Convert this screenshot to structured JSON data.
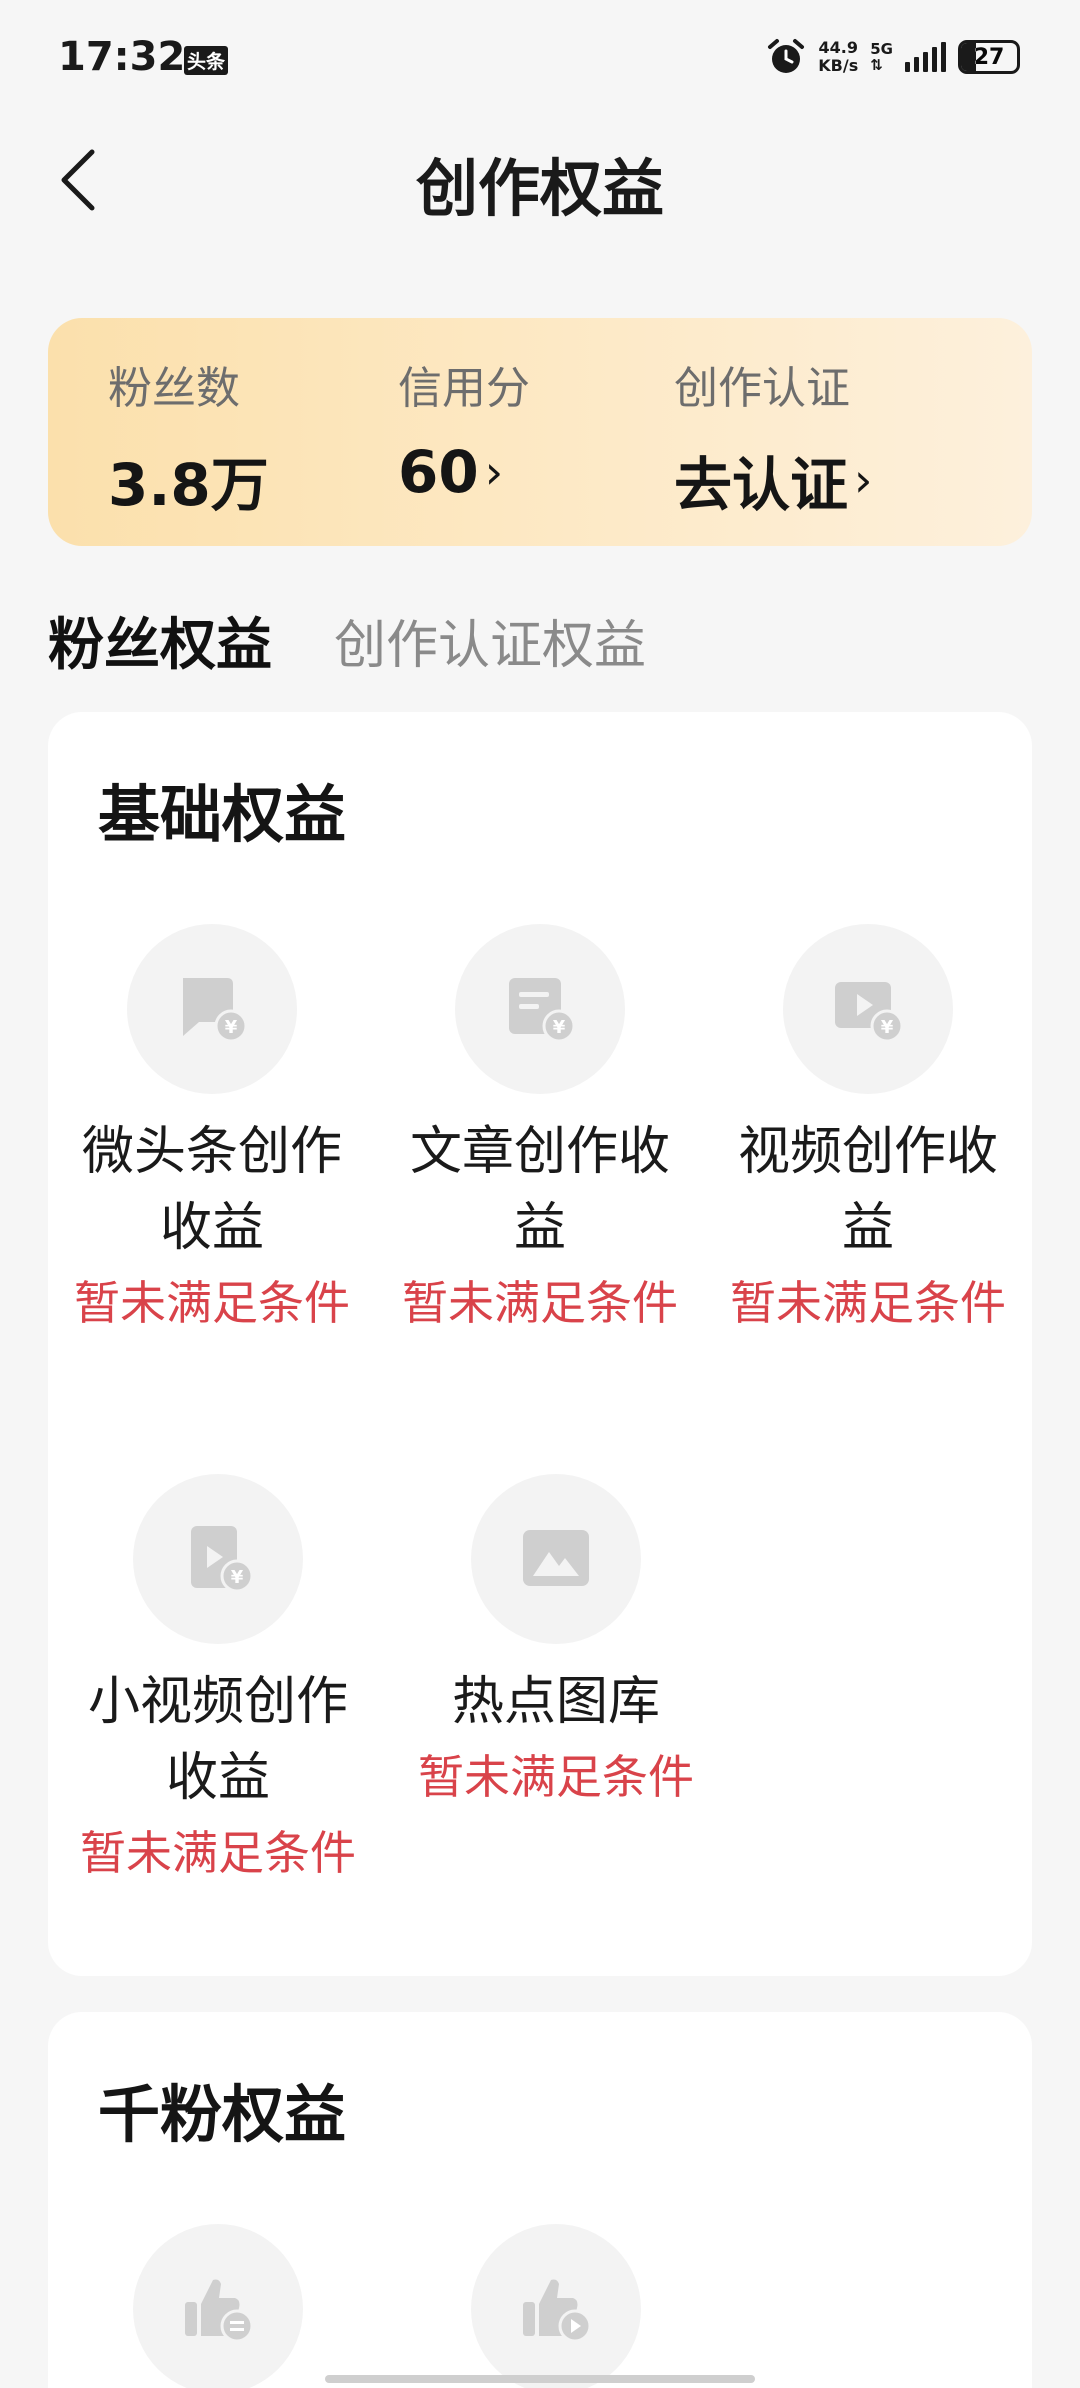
{
  "status_bar": {
    "time": "17:32",
    "app_badge": "头条",
    "net_speed_value": "44.9",
    "net_speed_unit": "KB/s",
    "network_type": "5G",
    "battery_level": "27",
    "battery_percent": 27
  },
  "nav": {
    "title": "创作权益"
  },
  "stats": {
    "fans_label": "粉丝数",
    "fans_value": "3.8万",
    "credit_label": "信用分",
    "credit_value": "60",
    "cert_label": "创作认证",
    "cert_value": "去认证",
    "chevron": "›"
  },
  "tabs": [
    {
      "label": "粉丝权益"
    },
    {
      "label": "创作认证权益"
    }
  ],
  "basic_section": {
    "title": "基础权益",
    "items": [
      {
        "name": "微头条创作收益",
        "status": "暂未满足条件",
        "icon": "chat-bubble-yuan-icon"
      },
      {
        "name": "文章创作收益",
        "status": "暂未满足条件",
        "icon": "article-yuan-icon"
      },
      {
        "name": "视频创作收益",
        "status": "暂未满足条件",
        "icon": "video-yuan-icon"
      },
      {
        "name": "小视频创作收益",
        "status": "暂未满足条件",
        "icon": "short-video-yuan-icon"
      },
      {
        "name": "热点图库",
        "status": "暂未满足条件",
        "icon": "image-gallery-icon"
      }
    ]
  },
  "thousand_section": {
    "title": "千粉权益",
    "items": [
      {
        "icon": "thumbs-up-article-icon"
      },
      {
        "icon": "thumbs-up-video-icon"
      }
    ]
  },
  "colors": {
    "status_red": "#d9434a",
    "stats_gradient_start": "#fbe0ac",
    "stats_gradient_end": "#fdf0dc"
  }
}
